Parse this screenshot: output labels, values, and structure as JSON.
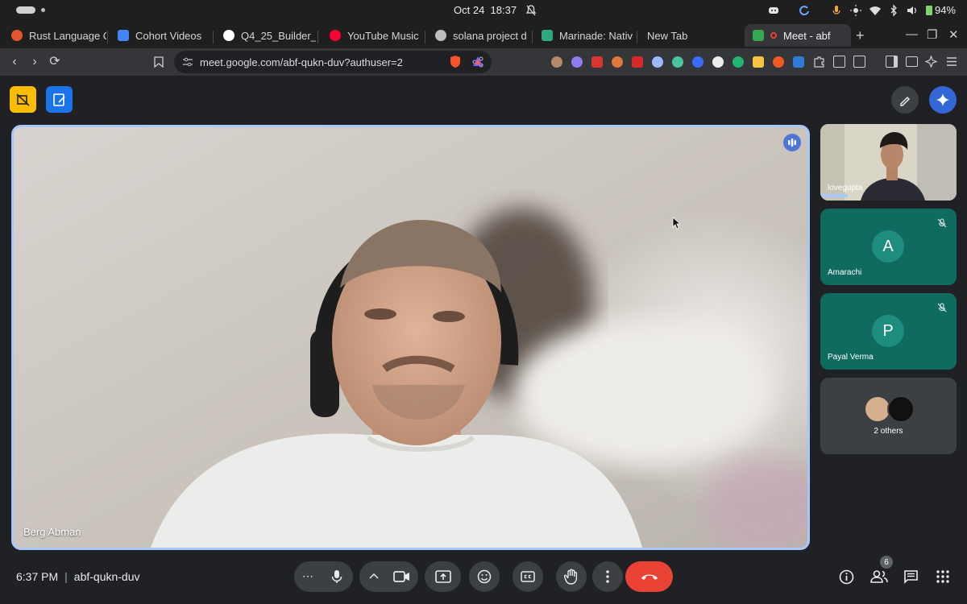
{
  "system": {
    "date": "Oct 24",
    "time": "18:37",
    "battery": "94%"
  },
  "tabs": [
    {
      "label": "Rust Language C",
      "favicon_color": "#e4572e"
    },
    {
      "label": "Cohort Videos",
      "favicon_color": "#4285f4"
    },
    {
      "label": "Q4_25_Builder_",
      "favicon_color": "#ffffff"
    },
    {
      "label": "YouTube Music",
      "favicon_color": "#ff0033"
    },
    {
      "label": "solana project d",
      "favicon_color": "#bdbdbd"
    },
    {
      "label": "Marinade: Nativ",
      "favicon_color": "#2fa87e"
    },
    {
      "label": "New Tab",
      "favicon_color": ""
    },
    {
      "label": "Meet - abf",
      "favicon_color": "#34a853",
      "active": true
    }
  ],
  "address_bar": {
    "url": "meet.google.com/abf-qukn-duv?authuser=2"
  },
  "main_speaker": {
    "name": "Berg Abman"
  },
  "participants": [
    {
      "name": "lovegupta",
      "type": "video"
    },
    {
      "name": "Amarachi",
      "initial": "A",
      "muted": true
    },
    {
      "name": "Payal Verma",
      "initial": "P",
      "muted": true
    }
  ],
  "others": {
    "label": "2 others"
  },
  "meeting": {
    "time": "6:37 PM",
    "separator": "|",
    "code": "abf-qukn-duv"
  },
  "people_count": "6",
  "colors": {
    "accent": "#a8c7fa",
    "end_call": "#ea4335",
    "tile_teal": "#0f6a60",
    "control_bg": "#3c4043"
  }
}
